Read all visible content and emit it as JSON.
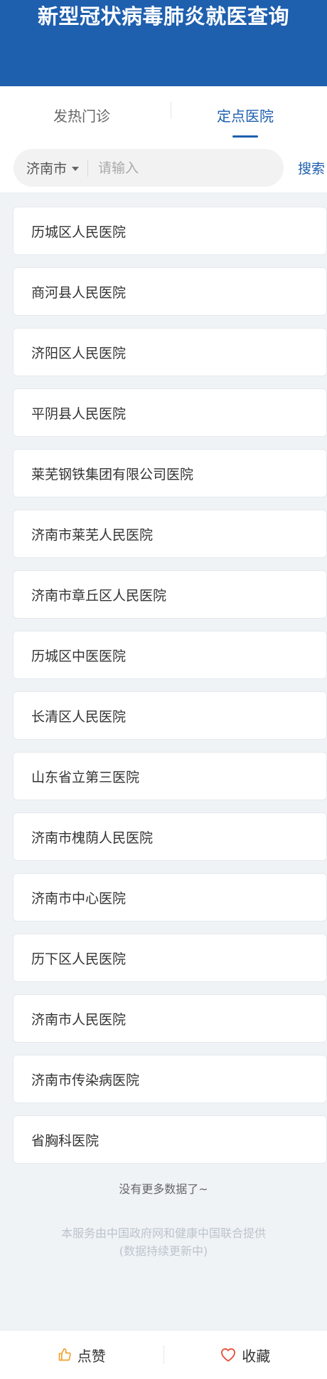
{
  "header": {
    "title": "新型冠状病毒肺炎就医查询"
  },
  "tabs": [
    {
      "label": "发热门诊",
      "active": false
    },
    {
      "label": "定点医院",
      "active": true
    }
  ],
  "search": {
    "city": "济南市",
    "placeholder": "请输入",
    "button_label": "搜索"
  },
  "hospitals": [
    "历城区人民医院",
    "商河县人民医院",
    "济阳区人民医院",
    "平阴县人民医院",
    "莱芜钢铁集团有限公司医院",
    "济南市莱芜人民医院",
    "济南市章丘区人民医院",
    "历城区中医医院",
    "长清区人民医院",
    "山东省立第三医院",
    "济南市槐荫人民医院",
    "济南市中心医院",
    "历下区人民医院",
    "济南市人民医院",
    "济南市传染病医院",
    "省胸科医院"
  ],
  "status": {
    "no_more": "没有更多数据了~"
  },
  "footer": {
    "line1": "本服务由中国政府网和健康中国联合提供",
    "line2": "(数据持续更新中)"
  },
  "bottom_bar": {
    "like_label": "点赞",
    "favorite_label": "收藏"
  },
  "colors": {
    "brand": "#1e5fae",
    "like_icon": "#f0a22e",
    "favorite_icon": "#e8503a"
  }
}
